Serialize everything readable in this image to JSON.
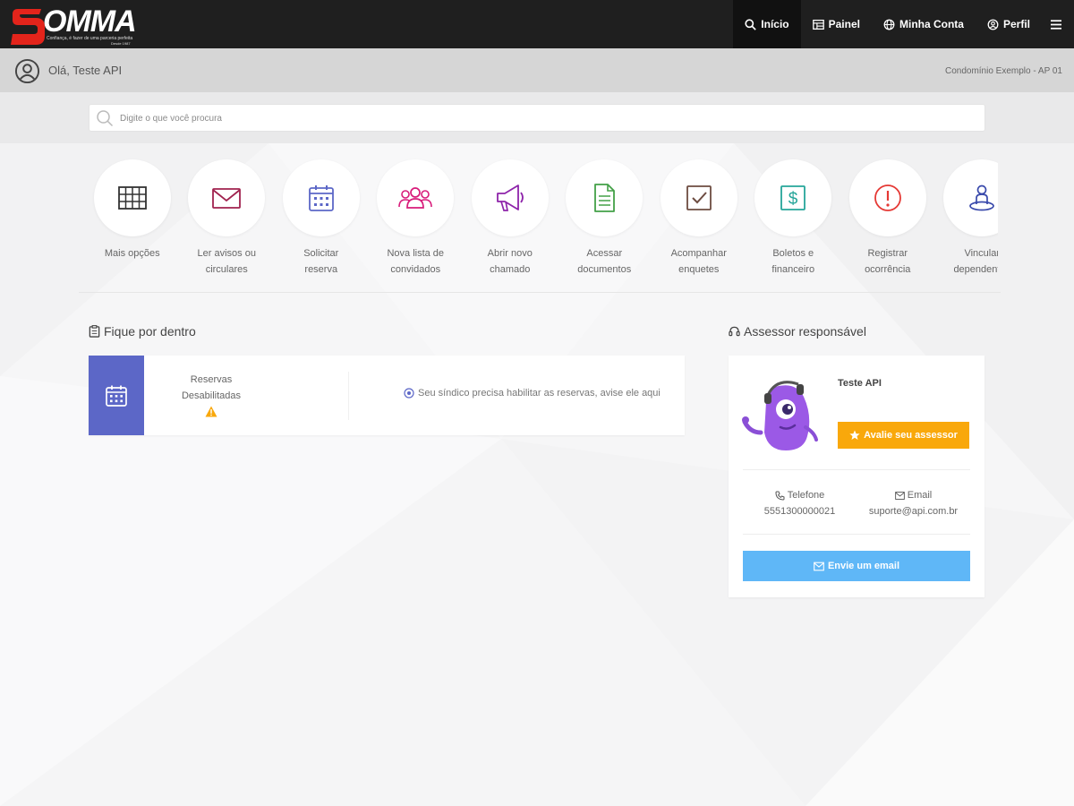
{
  "brand": {
    "name": "OMMA",
    "tagline": "Confiança, é fazer de uma parceria perfeita",
    "year": "Desde 1987",
    "colors": {
      "accent": "#e3241b",
      "dark": "#1f1f1f"
    }
  },
  "nav": {
    "items": [
      {
        "label": "Início",
        "icon": "search-icon",
        "active": true
      },
      {
        "label": "Painel",
        "icon": "dashboard-icon"
      },
      {
        "label": "Minha Conta",
        "icon": "globe-icon"
      },
      {
        "label": "Perfil",
        "icon": "user-circle-icon"
      }
    ],
    "menu_icon": "hamburger-icon"
  },
  "greeting": {
    "text": "Olá, Teste API",
    "condo": "Condomínio Exemplo - AP 01"
  },
  "search": {
    "placeholder": "Digite o que você procura"
  },
  "shortcuts": [
    {
      "line1": "Mais opções",
      "line2": "",
      "icon": "grid-icon",
      "color": "#333333"
    },
    {
      "line1": "Ler avisos ou",
      "line2": "circulares",
      "icon": "envelope-icon",
      "color": "#a0224e"
    },
    {
      "line1": "Solicitar",
      "line2": "reserva",
      "icon": "calendar-icon",
      "color": "#5c67c7"
    },
    {
      "line1": "Nova lista de",
      "line2": "convidados",
      "icon": "users-icon",
      "color": "#d81b7a"
    },
    {
      "line1": "Abrir novo",
      "line2": "chamado",
      "icon": "megaphone-icon",
      "color": "#8e24aa"
    },
    {
      "line1": "Acessar",
      "line2": "documentos",
      "icon": "document-icon",
      "color": "#43a047"
    },
    {
      "line1": "Acompanhar",
      "line2": "enquetes",
      "icon": "checkbox-icon",
      "color": "#6d4c41"
    },
    {
      "line1": "Boletos e",
      "line2": "financeiro",
      "icon": "dollar-icon",
      "color": "#26a69a"
    },
    {
      "line1": "Registrar",
      "line2": "ocorrência",
      "icon": "alert-icon",
      "color": "#e53935"
    },
    {
      "line1": "Vincular",
      "line2": "dependentes",
      "icon": "person-icon",
      "color": "#3949ab"
    }
  ],
  "news": {
    "title": "Fique por dentro",
    "status_line1": "Reservas",
    "status_line2": "Desabilitadas",
    "message": "Seu síndico precisa habilitar as reservas, avise ele aqui"
  },
  "assessor": {
    "title": "Assessor responsável",
    "name": "Teste API",
    "rate_label": "Avalie seu assessor",
    "phone_label": "Telefone",
    "phone": "5551300000021",
    "email_label": "Email",
    "email": "suporte@api.com.br",
    "email_button": "Envie um email"
  }
}
